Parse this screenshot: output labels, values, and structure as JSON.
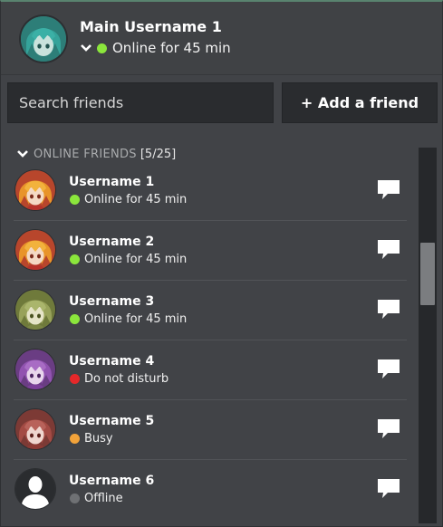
{
  "header": {
    "username": "Main Username 1",
    "status": {
      "text": "Online for 45 min",
      "color": "#8be63c"
    }
  },
  "search": {
    "placeholder": "Search friends",
    "value": ""
  },
  "add_friend_label": "+ Add a friend",
  "section": {
    "label": "ONLINE FRIENDS",
    "count": "[5/25]"
  },
  "friends": [
    {
      "name": "Username 1",
      "status": "Online for 45 min",
      "status_color": "#8be63c",
      "avatar": "orange-hair-avatar"
    },
    {
      "name": "Username 2",
      "status": "Online for 45 min",
      "status_color": "#8be63c",
      "avatar": "orange-hair-avatar"
    },
    {
      "name": "Username 3",
      "status": "Online for 45 min",
      "status_color": "#8be63c",
      "avatar": "olive-hair-avatar"
    },
    {
      "name": "Username 4",
      "status": "Do not disturb",
      "status_color": "#e5282a",
      "avatar": "purple-hair-avatar"
    },
    {
      "name": "Username 5",
      "status": "Busy",
      "status_color": "#f2a33a",
      "avatar": "red-hair-avatar"
    },
    {
      "name": "Username 6",
      "status": "Offline",
      "status_color": "#6f7174",
      "avatar": "default-silhouette-avatar"
    }
  ],
  "colors": {
    "panel_bg": "#414347",
    "accent_top": "#59836f",
    "input_bg": "#2a2c2f"
  }
}
